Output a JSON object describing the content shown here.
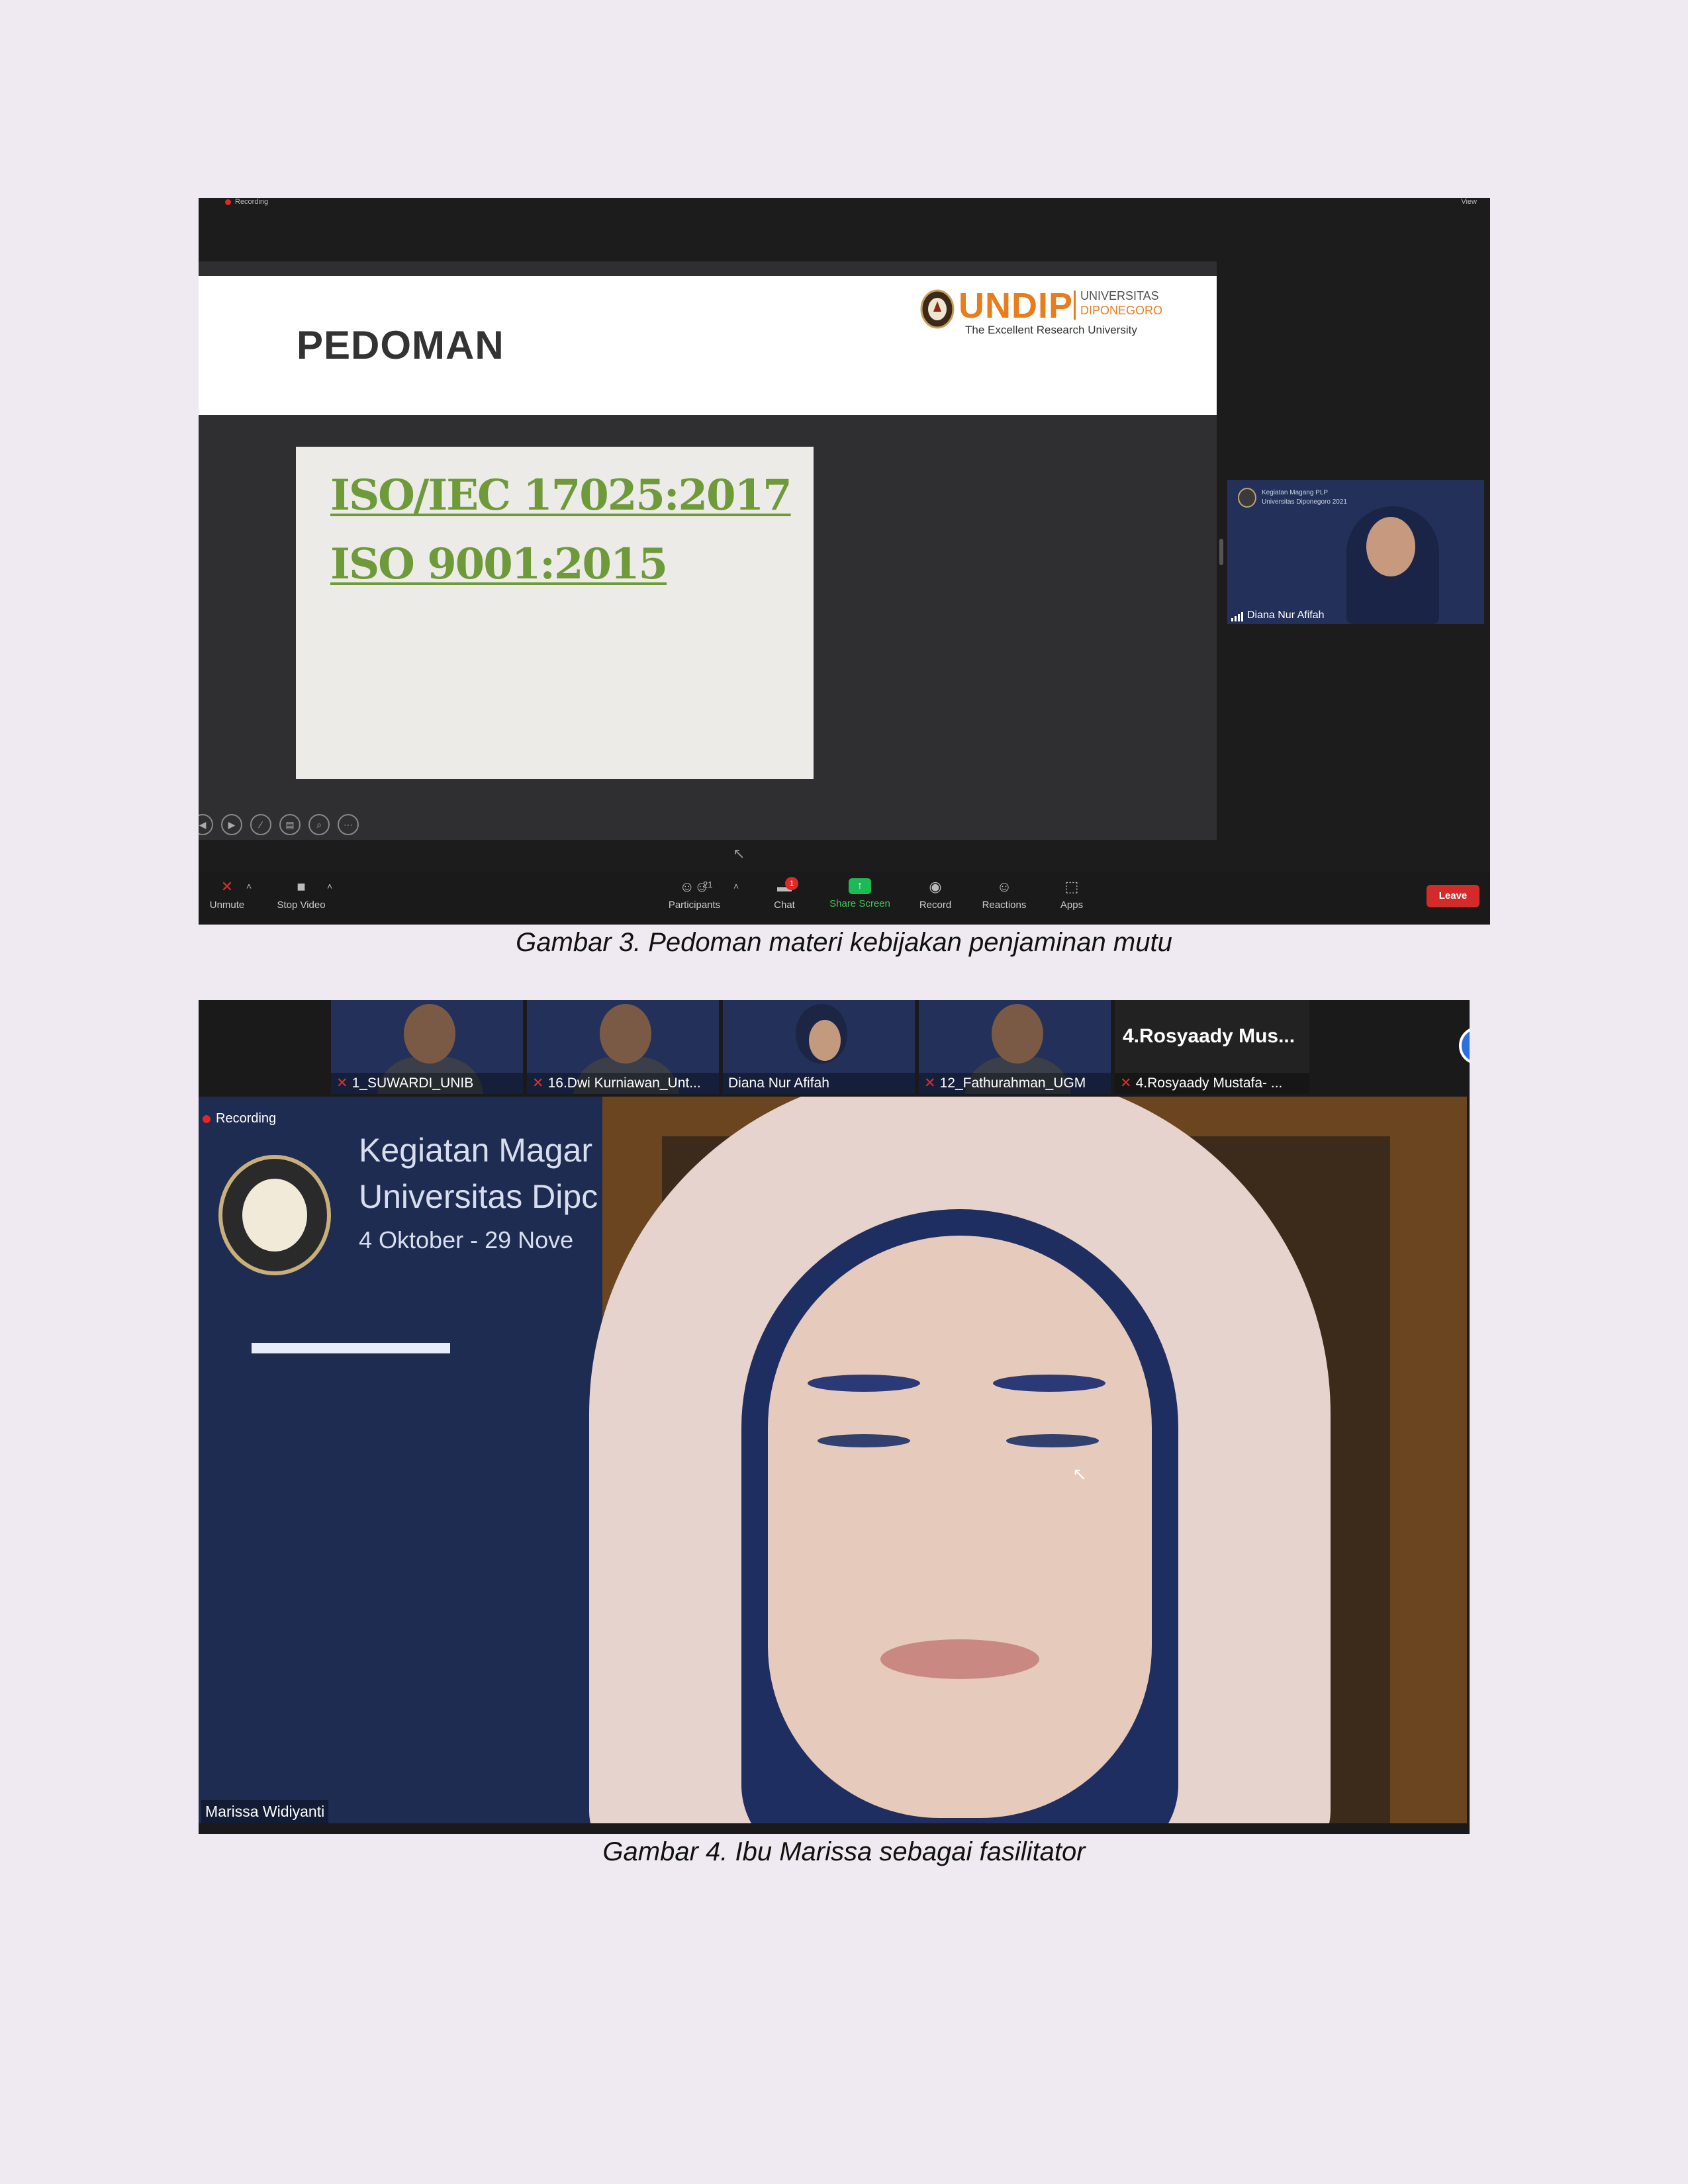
{
  "figure1": {
    "recording_label": "Recording",
    "view_label": "View",
    "slide": {
      "title": "PEDOMAN",
      "logo": {
        "word": "UNDIP",
        "line1": "UNIVERSITAS",
        "line2": "DIPONEGORO",
        "tagline": "The Excellent Research University"
      },
      "items": [
        "ISO/IEC 17025:2017",
        "ISO 9001:2015"
      ]
    },
    "thumbnail": {
      "caption_line1": "Kegiatan Magang PLP",
      "caption_line2": "Universitas Diponegoro 2021",
      "name": "Diana Nur Afifah"
    },
    "toolbar": {
      "unmute": "Unmute",
      "stop_video": "Stop Video",
      "participants": "Participants",
      "participants_count": "21",
      "chat": "Chat",
      "chat_badge": "1",
      "share_screen": "Share Screen",
      "record": "Record",
      "reactions": "Reactions",
      "apps": "Apps",
      "leave": "Leave"
    },
    "colors": {
      "accent_green": "#3ec657",
      "leave_red": "#d32a2a",
      "undip_orange": "#e87d1e",
      "iso_green": "#6e9a3a"
    }
  },
  "caption1": "Gambar 3. Pedoman materi kebijakan penjaminan mutu",
  "figure2": {
    "participants": [
      {
        "name": "1_SUWARDI_UNIB",
        "muted": true
      },
      {
        "name": "16.Dwi Kurniawan_Unt...",
        "muted": true
      },
      {
        "name": "Diana Nur Afifah",
        "muted": false
      },
      {
        "name": "12_Fathurahman_UGM",
        "muted": true
      },
      {
        "name": "4.Rosyaady Mustafa- ...",
        "muted": true,
        "display_title": "4.Rosyaady  Mus..."
      }
    ],
    "recording_label": "Recording",
    "background_text": {
      "line1": "Kegiatan Magar",
      "line2": "Universitas Dipc",
      "line3": "4 Oktober - 29 Nove"
    },
    "speaker_name": "Marissa Widiyanti"
  },
  "caption2": "Gambar 4. Ibu Marissa sebagai fasilitator"
}
